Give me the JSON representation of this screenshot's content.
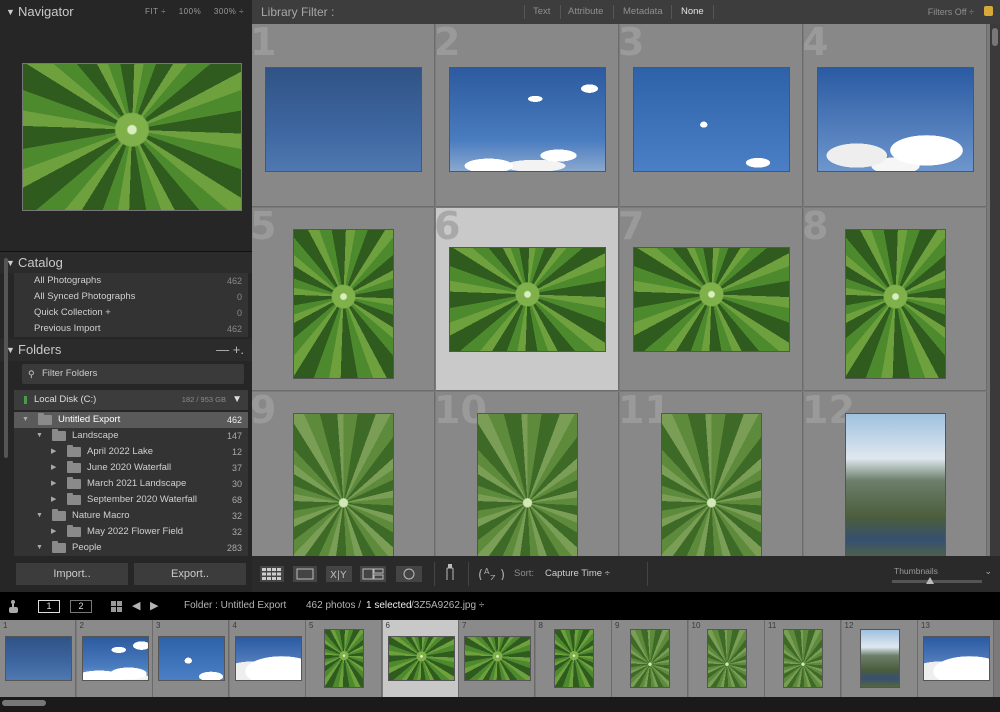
{
  "navigator": {
    "title": "Navigator",
    "fit": "FIT ÷",
    "zoom100": "100%",
    "zoom300": "300% ÷"
  },
  "catalog": {
    "title": "Catalog",
    "items": [
      {
        "label": "All Photographs",
        "count": "462"
      },
      {
        "label": "All Synced Photographs",
        "count": "0"
      },
      {
        "label": "Quick Collection +",
        "count": "0"
      },
      {
        "label": "Previous Import",
        "count": "462"
      }
    ]
  },
  "folders": {
    "title": "Folders",
    "controls": "—  +.",
    "filter_placeholder": "Filter Folders",
    "disk": {
      "label": "Local Disk (C:)",
      "size": "182 / 953 GB"
    },
    "tree": [
      {
        "label": "Untitled Export",
        "count": "462"
      },
      {
        "label": "Landscape",
        "count": "147"
      },
      {
        "label": "April 2022 Lake",
        "count": "12"
      },
      {
        "label": "June 2020 Waterfall",
        "count": "37"
      },
      {
        "label": "March 2021 Landscape",
        "count": "30"
      },
      {
        "label": "September 2020 Waterfall",
        "count": "68"
      },
      {
        "label": "Nature Macro",
        "count": "32"
      },
      {
        "label": "May 2022 Flower Field",
        "count": "32"
      },
      {
        "label": "People",
        "count": "283"
      }
    ]
  },
  "buttons": {
    "import": "Import..",
    "export": "Export.."
  },
  "filter_bar": {
    "label": "Library Filter :",
    "tabs": [
      "Text",
      "Attribute",
      "Metadata",
      "None"
    ],
    "active_tab": "None",
    "filters_off": "Filters Off ÷"
  },
  "grid": {
    "cells": [
      {
        "n": "1",
        "type": "sky1"
      },
      {
        "n": "2",
        "type": "sky2"
      },
      {
        "n": "3",
        "type": "sky3"
      },
      {
        "n": "4",
        "type": "sky4"
      },
      {
        "n": "5",
        "type": "plant"
      },
      {
        "n": "6",
        "type": "plant"
      },
      {
        "n": "7",
        "type": "plant"
      },
      {
        "n": "8",
        "type": "plant"
      },
      {
        "n": "9",
        "type": "plantdim"
      },
      {
        "n": "10",
        "type": "plantdim"
      },
      {
        "n": "11",
        "type": "plantdim"
      },
      {
        "n": "12",
        "type": "mount"
      }
    ],
    "selected": "6"
  },
  "toolbar": {
    "sort_label": "Sort:",
    "sort_value": "Capture Time ÷",
    "thumbnails_label": "Thumbnails"
  },
  "status": {
    "page1": "1",
    "page2": "2",
    "source": "Folder : Untitled Export",
    "count": "462 photos /",
    "selected": "1 selected",
    "filename": "/3Z5A9262.jpg ÷"
  },
  "filmstrip": {
    "cells": [
      {
        "n": "1",
        "type": "sky1"
      },
      {
        "n": "2",
        "type": "sky2"
      },
      {
        "n": "3",
        "type": "sky3"
      },
      {
        "n": "4",
        "type": "sky4"
      },
      {
        "n": "5",
        "type": "plant"
      },
      {
        "n": "6",
        "type": "plant"
      },
      {
        "n": "7",
        "type": "plant"
      },
      {
        "n": "8",
        "type": "plant"
      },
      {
        "n": "9",
        "type": "plantdim"
      },
      {
        "n": "10",
        "type": "plantdim"
      },
      {
        "n": "11",
        "type": "plantdim"
      },
      {
        "n": "12",
        "type": "mount"
      },
      {
        "n": "13",
        "type": "sky4"
      }
    ],
    "selected": "6"
  }
}
